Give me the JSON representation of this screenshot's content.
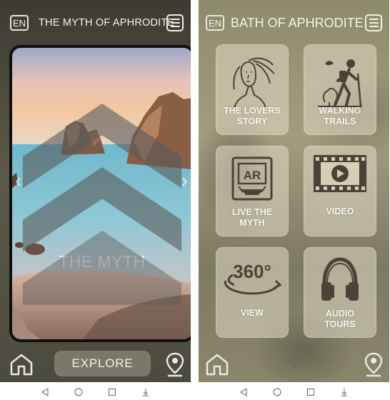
{
  "left_screen": {
    "language": "EN",
    "title": "THE MYTH OF APHRODITE",
    "card_title": "THE MYTH",
    "explore_label": "EXPLORE"
  },
  "right_screen": {
    "language": "EN",
    "title": "BATH OF APHRODITE",
    "tiles": [
      {
        "label_line1": "THE LOVERS",
        "label_line2": "STORY",
        "icon": "venus-portrait-icon"
      },
      {
        "label_line1": "WALKING",
        "label_line2": "TRAILS",
        "icon": "hiker-icon"
      },
      {
        "label_line1": "LIVE THE",
        "label_line2": "MYTH",
        "icon": "ar-phone-icon"
      },
      {
        "label_line1": "VIDEO",
        "label_line2": "",
        "icon": "film-play-icon"
      },
      {
        "label_line1": "VIEW",
        "label_line2": "",
        "icon": "360-icon",
        "icon_text": "360°"
      },
      {
        "label_line1": "AUDIO",
        "label_line2": "TOURS",
        "icon": "headphones-icon"
      }
    ]
  },
  "colors": {
    "tile_bg": "#e2dcc4",
    "text": "#fbf8ef",
    "left_bg": "#4b4a3e",
    "right_bg": "#8d8a6c"
  }
}
